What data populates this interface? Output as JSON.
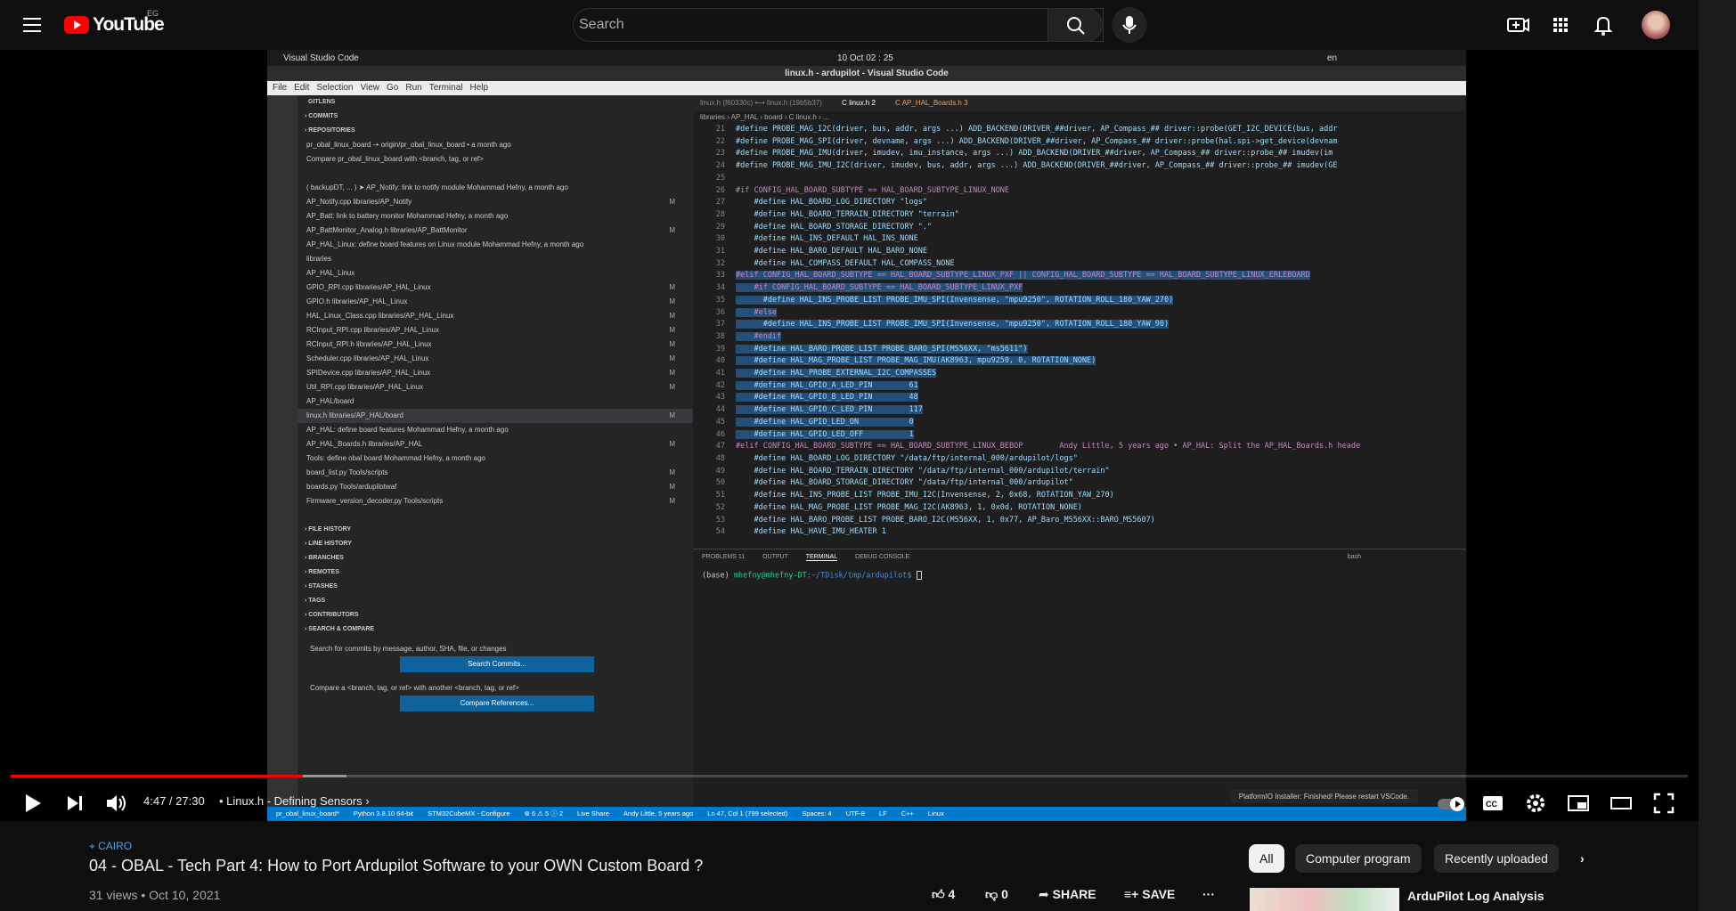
{
  "header": {
    "logo_text": "YouTube",
    "country_code": "EG",
    "search_placeholder": "Search"
  },
  "video_frame": {
    "gnome": {
      "app": "Visual Studio Code",
      "clock": "10 Oct  02 : 25",
      "lang": "en"
    },
    "window_title": "linux.h - ardupilot - Visual Studio Code",
    "menu": [
      "File",
      "Edit",
      "Selection",
      "View",
      "Go",
      "Run",
      "Terminal",
      "Help"
    ],
    "sidebar": {
      "title": "GITLENS",
      "rows": [
        {
          "t": "COMMITS",
          "c": "hdr"
        },
        {
          "t": "REPOSITORIES",
          "c": "hdr"
        },
        {
          "t": "        pr_obal_linux_board  ⇢ origin/pr_obal_linux_board • a month ago",
          "c": ""
        },
        {
          "t": "            Compare pr_obal_linux_board with <branch, tag, or ref>",
          "c": ""
        },
        {
          "t": "",
          "c": ""
        },
        {
          "t": "      ( backupDT, ... ) ➤ AP_Notify: link to notify module  Mohammad Hefny, a month ago",
          "c": ""
        },
        {
          "t": "            AP_Notify.cpp  libraries/AP_Notify",
          "c": "",
          "m": "M"
        },
        {
          "t": "      AP_Batt: link to battery monitor  Mohammad Hefny, a month ago",
          "c": ""
        },
        {
          "t": "            AP_BattMonitor_Analog.h  libraries/AP_BattMonitor",
          "c": "",
          "m": "M"
        },
        {
          "t": "      AP_HAL_Linux: define board features on Linux module  Mohammad Hefny, a month ago",
          "c": ""
        },
        {
          "t": "        libraries",
          "c": ""
        },
        {
          "t": "          AP_HAL_Linux",
          "c": ""
        },
        {
          "t": "            GPIO_RPI.cpp  libraries/AP_HAL_Linux",
          "c": "",
          "m": "M"
        },
        {
          "t": "            GPIO.h  libraries/AP_HAL_Linux",
          "c": "",
          "m": "M"
        },
        {
          "t": "            HAL_Linux_Class.cpp  libraries/AP_HAL_Linux",
          "c": "",
          "m": "M"
        },
        {
          "t": "            RCInput_RPI.cpp  libraries/AP_HAL_Linux",
          "c": "",
          "m": "M"
        },
        {
          "t": "            RCInput_RPI.h  libraries/AP_HAL_Linux",
          "c": "",
          "m": "M"
        },
        {
          "t": "            Scheduler.cpp  libraries/AP_HAL_Linux",
          "c": "",
          "m": "M"
        },
        {
          "t": "            SPIDevice.cpp  libraries/AP_HAL_Linux",
          "c": "",
          "m": "M"
        },
        {
          "t": "            Util_RPI.cpp  libraries/AP_HAL_Linux",
          "c": "",
          "m": "M"
        },
        {
          "t": "          AP_HAL/board",
          "c": ""
        },
        {
          "t": "            linux.h  libraries/AP_HAL/board",
          "c": "sel",
          "m": "M"
        },
        {
          "t": "      AP_HAL: define board features  Mohammad Hefny, a month ago",
          "c": ""
        },
        {
          "t": "            AP_HAL_Boards.h  libraries/AP_HAL",
          "c": "",
          "m": "M"
        },
        {
          "t": "      Tools: define obal board  Mohammad Hefny, a month ago",
          "c": ""
        },
        {
          "t": "            board_list.py  Tools/scripts",
          "c": "",
          "m": "M"
        },
        {
          "t": "            boards.py  Tools/ardupilotwaf",
          "c": "",
          "m": "M"
        },
        {
          "t": "            Firmware_version_decoder.py  Tools/scripts",
          "c": "",
          "m": "M"
        },
        {
          "t": "",
          "c": ""
        },
        {
          "t": "FILE HISTORY",
          "c": "hdr"
        },
        {
          "t": "LINE HISTORY",
          "c": "hdr"
        },
        {
          "t": "BRANCHES",
          "c": "hdr"
        },
        {
          "t": "REMOTES",
          "c": "hdr"
        },
        {
          "t": "STASHES",
          "c": "hdr"
        },
        {
          "t": "TAGS",
          "c": "hdr"
        },
        {
          "t": "CONTRIBUTORS",
          "c": "hdr"
        },
        {
          "t": "SEARCH & COMPARE",
          "c": "hdr"
        }
      ],
      "search_text": "Search for commits by message, author, SHA, file, or changes",
      "search_button": "Search Commits...",
      "compare_text": "Compare a <branch, tag, or ref> with another <branch, tag, or ref>",
      "compare_button": "Compare References..."
    },
    "tabs": [
      "linux.h (f60330c) ⟷ linux.h (19b5b37)",
      "C linux.h  2",
      "C AP_HAL_Boards.h  3"
    ],
    "breadcrumbs": "libraries › AP_HAL › board › C linux.h › ...",
    "code": [
      {
        "n": "21",
        "t": "#define PROBE_MAG_I2C(driver, bus, addr, args ...) ADD_BACKEND(DRIVER_##driver, AP_Compass_## driver::probe(GET_I2C_DEVICE(bus, addr"
      },
      {
        "n": "22",
        "t": "#define PROBE_MAG_SPI(driver, devname, args ...) ADD_BACKEND(DRIVER_##driver, AP_Compass_## driver::probe(hal.spi->get_device(devnam"
      },
      {
        "n": "23",
        "t": "#define PROBE_MAG_IMU(driver, imudev, imu_instance, args ...) ADD_BACKEND(DRIVER_##driver, AP_Compass_## driver::probe_## imudev(im"
      },
      {
        "n": "24",
        "t": "#define PROBE_MAG_IMU_I2C(driver, imudev, bus, addr, args ...) ADD_BACKEND(DRIVER_##driver, AP_Compass_## driver::probe_## imudev(GE"
      },
      {
        "n": "25",
        "t": ""
      },
      {
        "n": "26",
        "t": "#if CONFIG_HAL_BOARD_SUBTYPE == HAL_BOARD_SUBTYPE_LINUX_NONE"
      },
      {
        "n": "27",
        "t": "    #define HAL_BOARD_LOG_DIRECTORY \"logs\""
      },
      {
        "n": "28",
        "t": "    #define HAL_BOARD_TERRAIN_DIRECTORY \"terrain\""
      },
      {
        "n": "29",
        "t": "    #define HAL_BOARD_STORAGE_DIRECTORY \".\""
      },
      {
        "n": "30",
        "t": "    #define HAL_INS_DEFAULT HAL_INS_NONE"
      },
      {
        "n": "31",
        "t": "    #define HAL_BARO_DEFAULT HAL_BARO_NONE"
      },
      {
        "n": "32",
        "t": "    #define HAL_COMPASS_DEFAULT HAL_COMPASS_NONE"
      },
      {
        "n": "33",
        "t": "#elif CONFIG_HAL_BOARD_SUBTYPE == HAL_BOARD_SUBTYPE_LINUX_PXF || CONFIG_HAL_BOARD_SUBTYPE == HAL_BOARD_SUBTYPE_LINUX_ERLEBOARD",
        "hl": true
      },
      {
        "n": "34",
        "t": "    #if CONFIG_HAL_BOARD_SUBTYPE == HAL_BOARD_SUBTYPE_LINUX_PXF",
        "hl": true
      },
      {
        "n": "35",
        "t": "      #define HAL_INS_PROBE_LIST PROBE_IMU_SPI(Invensense, \"mpu9250\", ROTATION_ROLL_180_YAW_270)",
        "hl": true
      },
      {
        "n": "36",
        "t": "    #else",
        "hl": true
      },
      {
        "n": "37",
        "t": "      #define HAL_INS_PROBE_LIST PROBE_IMU_SPI(Invensense, \"mpu9250\", ROTATION_ROLL_180_YAW_90)",
        "hl": true
      },
      {
        "n": "38",
        "t": "    #endif",
        "hl": true
      },
      {
        "n": "39",
        "t": "    #define HAL_BARO_PROBE_LIST PROBE_BARO_SPI(MS56XX, \"ms5611\")",
        "hl": true
      },
      {
        "n": "40",
        "t": "    #define HAL_MAG_PROBE_LIST PROBE_MAG_IMU(AK8963, mpu9250, 0, ROTATION_NONE)",
        "hl": true
      },
      {
        "n": "41",
        "t": "    #define HAL_PROBE_EXTERNAL_I2C_COMPASSES",
        "hl": true
      },
      {
        "n": "42",
        "t": "    #define HAL_GPIO_A_LED_PIN        61",
        "hl": true
      },
      {
        "n": "43",
        "t": "    #define HAL_GPIO_B_LED_PIN        48",
        "hl": true
      },
      {
        "n": "44",
        "t": "    #define HAL_GPIO_C_LED_PIN        117",
        "hl": true
      },
      {
        "n": "45",
        "t": "    #define HAL_GPIO_LED_ON           0",
        "hl": true
      },
      {
        "n": "46",
        "t": "    #define HAL_GPIO_LED_OFF          1",
        "hl": true
      },
      {
        "n": "47",
        "t": "#elif CONFIG_HAL_BOARD_SUBTYPE == HAL_BOARD_SUBTYPE_LINUX_BEBOP        Andy Little, 5 years ago • AP_HAL: Split the AP_HAL_Boards.h heade"
      },
      {
        "n": "48",
        "t": "    #define HAL_BOARD_LOG_DIRECTORY \"/data/ftp/internal_000/ardupilot/logs\""
      },
      {
        "n": "49",
        "t": "    #define HAL_BOARD_TERRAIN_DIRECTORY \"/data/ftp/internal_000/ardupilot/terrain\""
      },
      {
        "n": "50",
        "t": "    #define HAL_BOARD_STORAGE_DIRECTORY \"/data/ftp/internal_000/ardupilot\""
      },
      {
        "n": "51",
        "t": "    #define HAL_INS_PROBE_LIST PROBE_IMU_I2C(Invensense, 2, 0x68, ROTATION_YAW_270)"
      },
      {
        "n": "52",
        "t": "    #define HAL_MAG_PROBE_LIST PROBE_MAG_I2C(AK8963, 1, 0x0d, ROTATION_NONE)"
      },
      {
        "n": "53",
        "t": "    #define HAL_BARO_PROBE_LIST PROBE_BARO_I2C(MS56XX, 1, 0x77, AP_Baro_MS56XX::BARO_MS5607)"
      },
      {
        "n": "54",
        "t": "    #define HAL_HAVE_IMU_HEATER 1"
      }
    ],
    "panel_tabs": [
      "PROBLEMS  11",
      "OUTPUT",
      "TERMINAL",
      "DEBUG CONSOLE"
    ],
    "terminal_shell": "bash",
    "terminal": {
      "env": "(base)",
      "user": "mhefny@mhefny-DT",
      "path": ":~/TDisk/tmp/ardupilot$"
    },
    "notification": "PlatformIO Installer: Finished! Please restart VSCode.",
    "status": [
      "pr_obal_linux_board*",
      "Python 3.8.10 64-bit",
      "STM32CubeMX - Configure",
      "⊗ 6 ⚠ 5 ⓘ 2",
      "Live Share",
      "Andy Little, 5 years ago",
      "Ln 47, Col 1 (799 selected)",
      "Spaces: 4",
      "UTF-8",
      "LF",
      "C++",
      "Linux"
    ]
  },
  "player": {
    "current_time": "4:47",
    "duration": "27:30",
    "time_separator": " / ",
    "chapter": "Linux.h - Defining Sensors",
    "progress": 0.174,
    "buffered": 0.2
  },
  "info": {
    "location": "CAIRO",
    "title": "04 - OBAL - Tech Part 4: How to Port Ardupilot Software to your OWN Custom Board ?",
    "views": "31 views",
    "date": "Oct 10, 2021",
    "likes": "4",
    "dislikes": "0",
    "share": "SHARE",
    "save": "SAVE"
  },
  "chips": [
    "All",
    "Computer program",
    "Recently uploaded"
  ],
  "recommended": {
    "title": "ArduPilot Log Analysis"
  }
}
